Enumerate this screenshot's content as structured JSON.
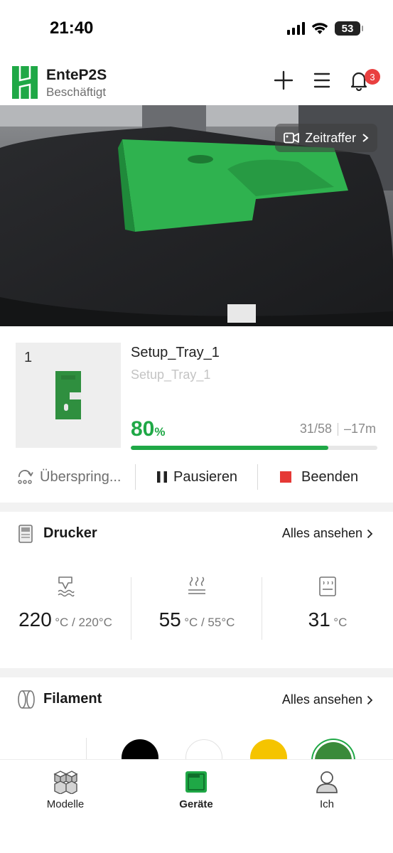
{
  "status_bar": {
    "time": "21:40",
    "battery": "53"
  },
  "header": {
    "device_name": "EnteP2S",
    "device_status": "Beschäftigt",
    "notification_count": "3",
    "icons": [
      "add-icon",
      "menu-icon",
      "bell-icon"
    ]
  },
  "camera": {
    "timelapse_label": "Zeitraffer"
  },
  "job": {
    "plate_number": "1",
    "title": "Setup_Tray_1",
    "subtitle": "Setup_Tray_1",
    "progress_value": "80",
    "progress_unit": "%",
    "progress_fraction": 0.8,
    "layers": "31/58",
    "remaining": "–17m"
  },
  "actions": {
    "skip_label": "Überspring...",
    "pause_label": "Pausieren",
    "stop_label": "Beenden"
  },
  "printer": {
    "title": "Drucker",
    "see_all": "Alles ansehen",
    "nozzle": {
      "value": "220",
      "unit": "°C / 220°C"
    },
    "bed": {
      "value": "55",
      "unit": "°C / 55°C"
    },
    "chamber": {
      "value": "31",
      "unit": "°C"
    }
  },
  "filament": {
    "title": "Filament",
    "see_all": "Alles ansehen",
    "spool_colors": [
      "#000000",
      "#ffffff",
      "#f5c400",
      "#3a8a3a"
    ]
  },
  "nav": {
    "models": "Modelle",
    "devices": "Geräte",
    "me": "Ich"
  },
  "colors": {
    "accent": "#1fa846",
    "stop": "#e53935",
    "badge": "#e94040"
  }
}
